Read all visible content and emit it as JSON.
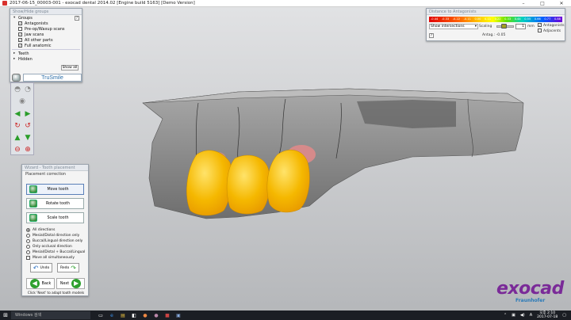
{
  "window": {
    "title": "2017-06-15_00003-001 - exocad dental 2014.02 [Engine build 5163] [Demo Version]",
    "controls": [
      "–",
      "□",
      "✕"
    ]
  },
  "groups_panel": {
    "header": "Show/Hide groups",
    "groups_label": "Groups",
    "help": "?",
    "items": [
      {
        "label": "Antagonists",
        "checked": true
      },
      {
        "label": "Pre-op/Waxup scans",
        "checked": false
      },
      {
        "label": "Jaw scans",
        "checked": true
      },
      {
        "label": "All other parts",
        "checked": true
      },
      {
        "label": "Full anatomic",
        "checked": true
      }
    ],
    "teeth_label": "Teeth",
    "hidden_label": "Hidden",
    "show_all": "Show all",
    "logo_text": "TruSmile"
  },
  "antagonist_panel": {
    "header": "Distance to Antagonists",
    "ticks": [
      "-0.44",
      "-0.33",
      "-0.22",
      "-0.11",
      "0.00",
      "0.11",
      "0.22",
      "0.33",
      "0.44",
      "0.55",
      "0.66",
      "0.77",
      "0.88"
    ],
    "dropdown_label": "Show intersections",
    "scaling_label": "Scaling",
    "scaling_value": "1",
    "scaling_unit": "mm",
    "antagonists_label": "Antagonists",
    "adjacents_label": "Adjacents",
    "antag_value": "Antag.: -0.05",
    "help": "?"
  },
  "wizard_panel": {
    "header": "Wizard - Tooth placement",
    "section": "Placement correction",
    "buttons": [
      "Move tooth",
      "Rotate tooth",
      "Scale tooth"
    ],
    "radios": [
      {
        "label": "All directions",
        "selected": true
      },
      {
        "label": "Mesial/Distal direction only",
        "selected": false
      },
      {
        "label": "Buccal/Lingual direction only",
        "selected": false
      },
      {
        "label": "Only occlusal direction",
        "selected": false
      },
      {
        "label": "Mesial/Distal + Buccal/Lingual",
        "selected": false
      }
    ],
    "checkbox": {
      "label": "Move all simultaneously",
      "checked": false
    },
    "undo": "Undo",
    "redo": "Redo",
    "back": "Back",
    "next": "Next",
    "hint": "Click 'Next' to adapt tooth models"
  },
  "brand": {
    "name": "exocad",
    "sub": "Fraunhofer"
  },
  "taskbar": {
    "search_placeholder": "Windows 검색",
    "lang": "A",
    "time": "오후 2:10",
    "date": "2017-07-18"
  },
  "colors": {
    "brand": "#7a2a98",
    "tooth_yellow": "#ffc400",
    "gum_gray": "#8f8f8f"
  }
}
